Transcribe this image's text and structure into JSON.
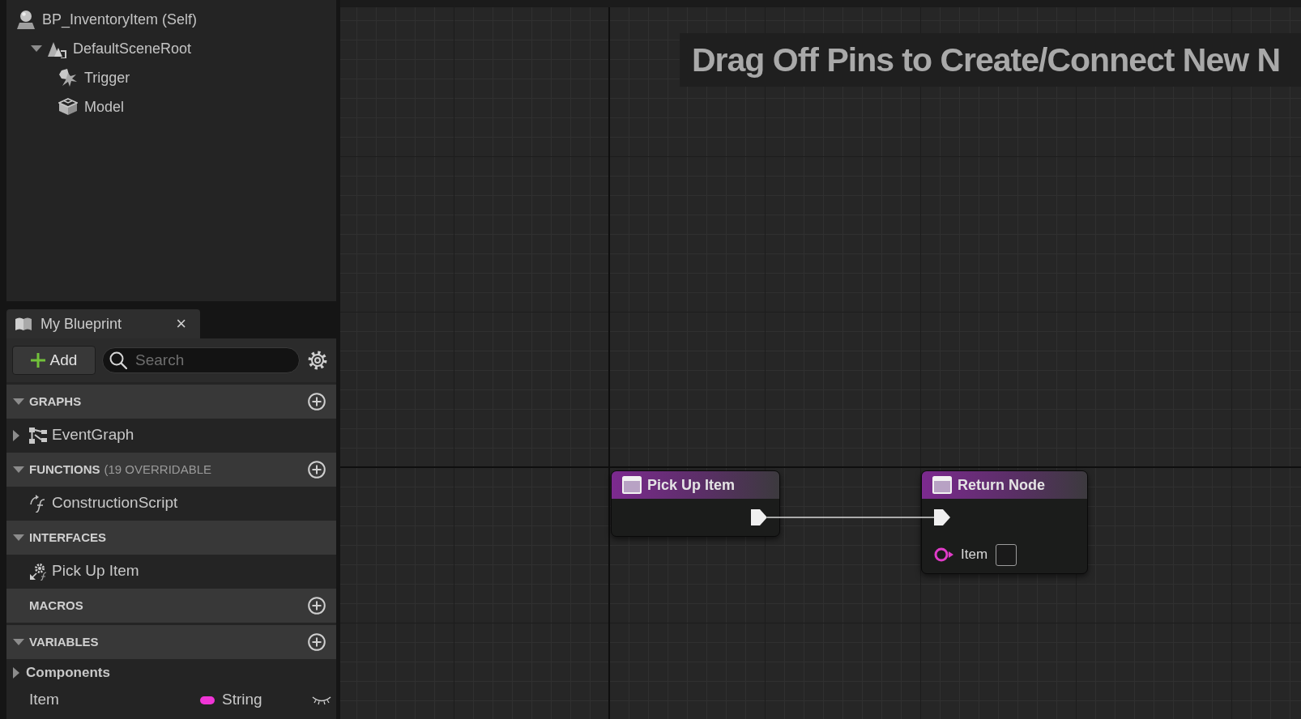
{
  "component_tree": {
    "items": [
      {
        "kind": "self",
        "label": "BP_InventoryItem (Self)",
        "children": [
          {
            "kind": "scene",
            "label": "DefaultSceneRoot",
            "expanded": true,
            "children": [
              {
                "kind": "collision",
                "label": "Trigger"
              },
              {
                "kind": "mesh",
                "label": "Model"
              }
            ]
          }
        ]
      }
    ]
  },
  "my_blueprint": {
    "tab": {
      "label": "My Blueprint",
      "close": "×"
    },
    "add_button": {
      "label": "Add"
    },
    "search": {
      "placeholder": "Search"
    },
    "sections": [
      {
        "title": "GRAPHS",
        "expanded": true,
        "add_button": true,
        "items": [
          {
            "kind": "graph",
            "label": "EventGraph",
            "expanded": false
          }
        ]
      },
      {
        "title": "FUNCTIONS",
        "note": "(19 OVERRIDABLE",
        "expanded": true,
        "add_button": true,
        "items": [
          {
            "kind": "function",
            "label": "ConstructionScript"
          }
        ]
      },
      {
        "title": "INTERFACES",
        "expanded": true,
        "add_button": false,
        "items": [
          {
            "kind": "interface",
            "label": "Pick Up Item"
          }
        ]
      },
      {
        "title": "MACROS",
        "add_button": true
      },
      {
        "title": "VARIABLES",
        "expanded": true,
        "add_button": true,
        "items": [
          {
            "kind": "category",
            "label": "Components",
            "expanded": false
          },
          {
            "kind": "variable",
            "label": "Item",
            "type": "String",
            "color": "#f035d6",
            "exposed": false
          }
        ]
      }
    ]
  },
  "graph": {
    "hint": "Drag Off Pins to Create/Connect New N",
    "nodes": [
      {
        "title": "Pick Up Item",
        "outputs": [
          {
            "kind": "exec",
            "connected": true
          }
        ]
      },
      {
        "title": "Return Node",
        "inputs": [
          {
            "kind": "exec",
            "connected": true
          },
          {
            "kind": "data",
            "label": "Item",
            "color": "#e03cc8",
            "connected": false
          }
        ]
      }
    ]
  }
}
